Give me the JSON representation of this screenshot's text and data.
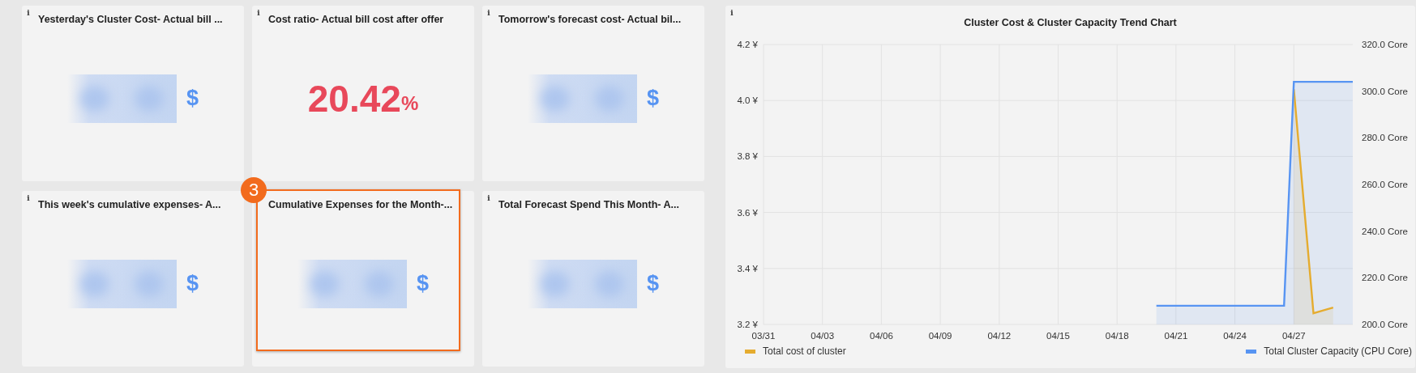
{
  "stat_panels": [
    {
      "info": "i",
      "title": "Yesterday's Cluster Cost- Actual bill ...",
      "kind": "redacted",
      "unit": "$",
      "highlighted": false
    },
    {
      "info": "i",
      "title": "Cost ratio- Actual bill cost after offer",
      "kind": "number",
      "value": "20.42",
      "unit": "%",
      "highlighted": false
    },
    {
      "info": "i",
      "title": "Tomorrow's forecast cost- Actual bil...",
      "kind": "redacted",
      "unit": "$",
      "highlighted": false
    },
    {
      "info": "i",
      "title": "This week's cumulative expenses- A...",
      "kind": "redacted",
      "unit": "$",
      "highlighted": false
    },
    {
      "title": "Cumulative Expenses for the Month-...",
      "kind": "redacted",
      "unit": "$",
      "highlighted": true,
      "callout": "3"
    },
    {
      "info": "i",
      "title": "Total Forecast Spend This Month- A...",
      "kind": "redacted",
      "unit": "$",
      "highlighted": false
    }
  ],
  "chart_panel": {
    "info": "i",
    "title": "Cluster Cost & Cluster Capacity Trend Chart",
    "chart_data": {
      "type": "area",
      "grid": true,
      "ylim": [
        3.2,
        4.2
      ],
      "categories": [
        "03/31",
        null,
        null,
        null,
        null,
        null,
        "04/03",
        null,
        null,
        null,
        null,
        null,
        "04/06",
        null,
        null,
        null,
        null,
        null,
        "04/09",
        null,
        null,
        null,
        null,
        null,
        "04/12",
        null,
        null,
        null,
        null,
        null,
        "04/15",
        null,
        null,
        null,
        null,
        null,
        "04/18",
        null,
        null,
        null,
        null,
        null,
        "04/21",
        null,
        null,
        null,
        null,
        null,
        "04/24",
        null,
        null,
        null,
        null,
        null,
        "04/27",
        null,
        null,
        null,
        null,
        null,
        null
      ],
      "yticks": [
        {
          "value": 3.2,
          "label": "3.2 ¥"
        },
        {
          "value": 3.4,
          "label": "3.4 ¥"
        },
        {
          "value": 3.6,
          "label": "3.6 ¥"
        },
        {
          "value": 3.8,
          "label": "3.8 ¥"
        },
        {
          "value": 4.0,
          "label": "4.0 ¥"
        },
        {
          "value": 4.2,
          "label": "4.2 ¥"
        }
      ],
      "y2lim": [
        200,
        320
      ],
      "y2ticks": [
        {
          "value": 200,
          "label": "200.0 Core"
        },
        {
          "value": 220,
          "label": "220.0 Core"
        },
        {
          "value": 240,
          "label": "240.0 Core"
        },
        {
          "value": 260,
          "label": "260.0 Core"
        },
        {
          "value": 280,
          "label": "280.0 Core"
        },
        {
          "value": 300,
          "label": "300.0 Core"
        },
        {
          "value": 320,
          "label": "320.0 Core"
        }
      ],
      "series": [
        {
          "name": "Total cost of cluster",
          "color": "#e5ac2f",
          "values": [
            null,
            null,
            null,
            null,
            null,
            null,
            null,
            null,
            null,
            null,
            null,
            null,
            null,
            null,
            null,
            null,
            null,
            null,
            null,
            null,
            null,
            null,
            null,
            null,
            null,
            null,
            null,
            null,
            null,
            null,
            null,
            null,
            null,
            null,
            null,
            null,
            null,
            null,
            null,
            null,
            null,
            null,
            null,
            null,
            null,
            null,
            null,
            null,
            null,
            null,
            null,
            null,
            null,
            null,
            4.04,
            3.64,
            3.24,
            3.25,
            3.26,
            null,
            null
          ]
        },
        {
          "name": "Total Cluster Capacity (CPU Core)",
          "color": "#5794f2",
          "axis": "y2",
          "values": [
            null,
            null,
            null,
            null,
            null,
            null,
            null,
            null,
            null,
            null,
            null,
            null,
            null,
            null,
            null,
            null,
            null,
            null,
            null,
            null,
            null,
            null,
            null,
            null,
            null,
            null,
            null,
            null,
            null,
            null,
            null,
            null,
            null,
            null,
            null,
            null,
            null,
            null,
            null,
            null,
            208,
            208,
            208,
            208,
            208,
            208,
            208,
            208,
            208,
            208,
            208,
            208,
            208,
            208,
            304,
            304,
            304,
            304,
            304,
            304,
            304
          ]
        }
      ]
    }
  }
}
